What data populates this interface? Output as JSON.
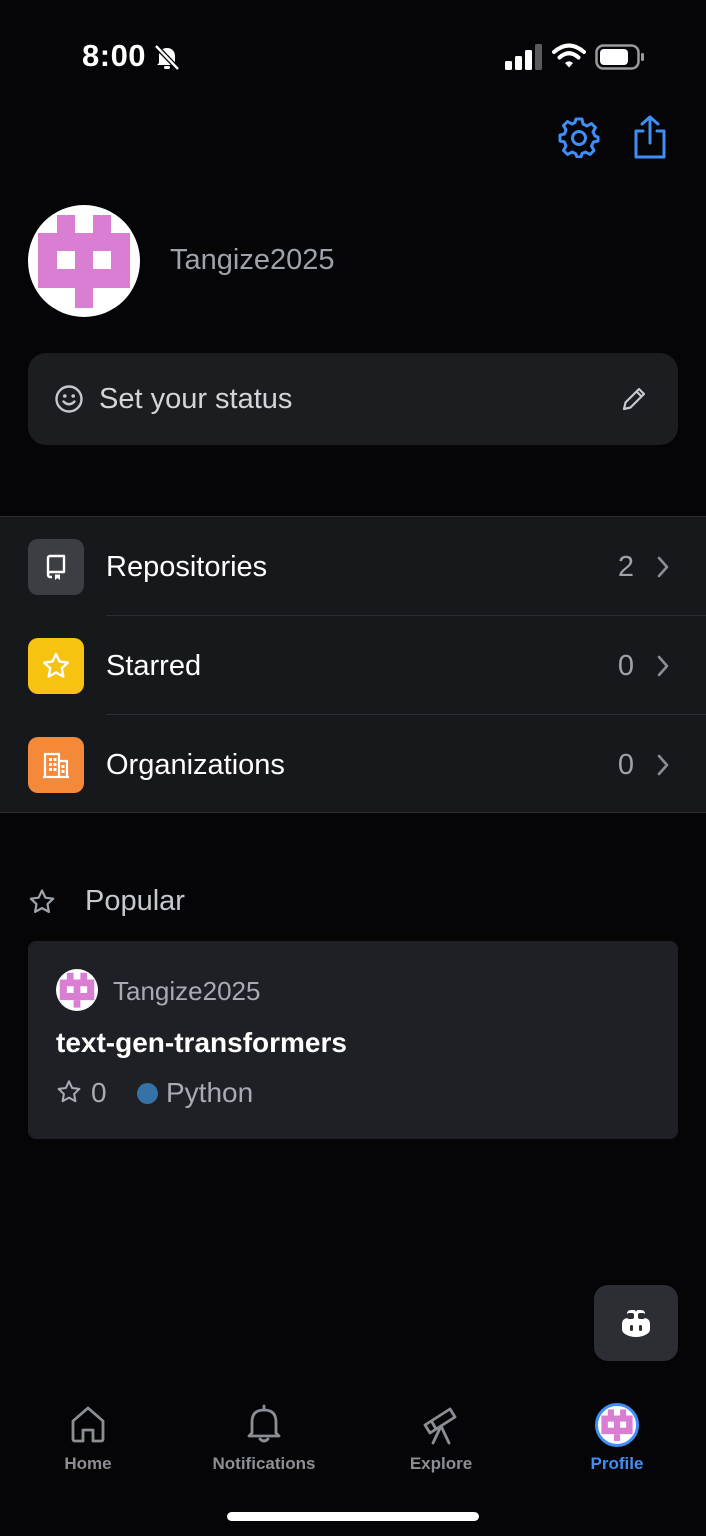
{
  "status_bar": {
    "time": "8:00"
  },
  "profile": {
    "username": "Tangize2025"
  },
  "status": {
    "placeholder": "Set your status"
  },
  "menu": {
    "items": [
      {
        "label": "Repositories",
        "count": "2",
        "icon": "repo-icon",
        "color": "#3d3e44"
      },
      {
        "label": "Starred",
        "count": "0",
        "icon": "star-icon",
        "color": "#f5c310"
      },
      {
        "label": "Organizations",
        "count": "0",
        "icon": "organization-icon",
        "color": "#f5893a"
      }
    ]
  },
  "popular": {
    "title": "Popular",
    "repo": {
      "owner": "Tangize2025",
      "name": "text-gen-transformers",
      "stars": "0",
      "language": "Python",
      "language_color": "#3572a5"
    }
  },
  "tabs": [
    {
      "label": "Home",
      "icon": "home-icon"
    },
    {
      "label": "Notifications",
      "icon": "bell-icon"
    },
    {
      "label": "Explore",
      "icon": "telescope-icon"
    },
    {
      "label": "Profile",
      "icon": "avatar",
      "active": true
    }
  ],
  "colors": {
    "accent": "#3f8ff7",
    "identicon": "#d97ed2"
  }
}
